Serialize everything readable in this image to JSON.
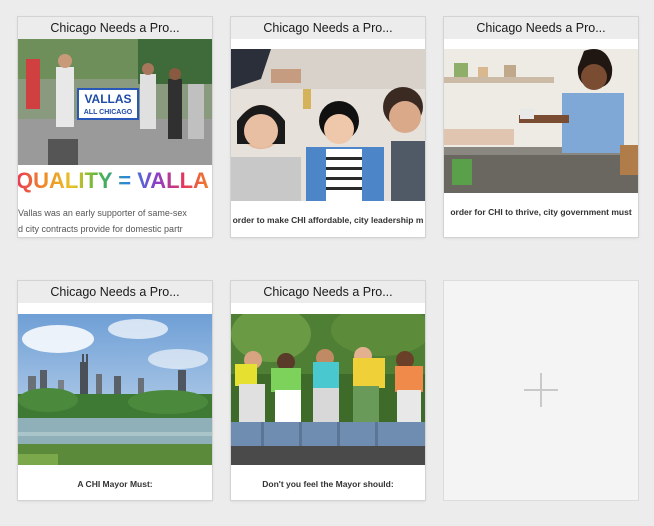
{
  "tabs": [
    {
      "title": "Chicago Needs a Pro...",
      "banner": "QUALITY = VALLA",
      "sign_top": "VALLAS",
      "sign_bottom": "ALL CHICAGO",
      "text_lines": [
        "Vallas was an early supporter of same-sex",
        "d city contracts provide for domestic partr"
      ]
    },
    {
      "title": "Chicago Needs a Pro...",
      "caption": "order to make CHI affordable, city leadership m"
    },
    {
      "title": "Chicago Needs a Pro...",
      "caption": "order for CHI to thrive, city government must"
    },
    {
      "title": "Chicago Needs a Pro...",
      "caption": "A CHI Mayor Must:"
    },
    {
      "title": "Chicago Needs a Pro...",
      "caption": "Don't you feel the Mayor should:"
    }
  ],
  "new_tab": {
    "icon": "plus-icon"
  },
  "colors": {
    "background": "#ececec",
    "title_bar": "#ececec",
    "plus": "#c9c9c9"
  }
}
